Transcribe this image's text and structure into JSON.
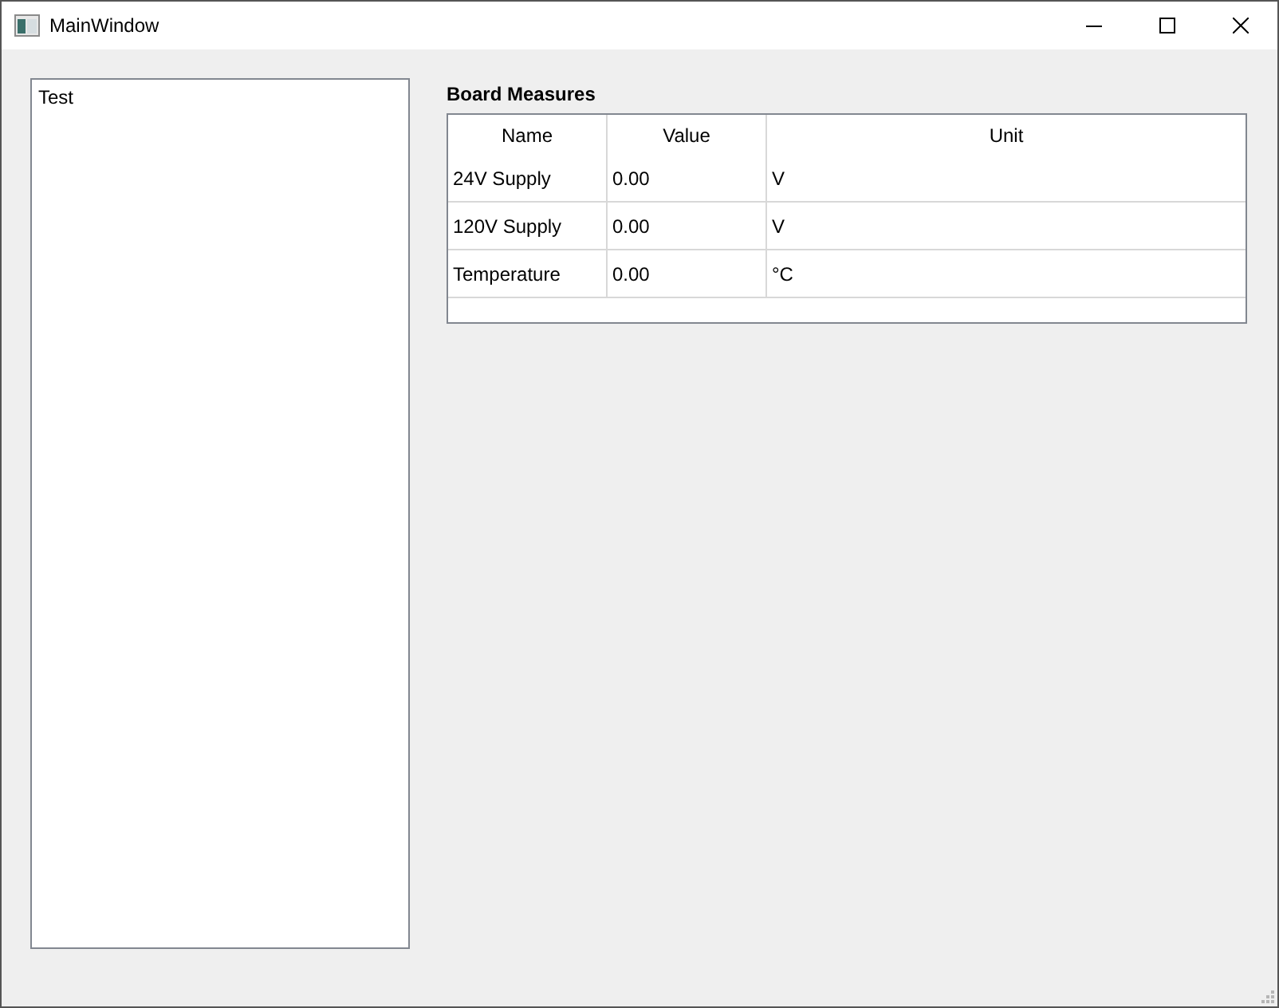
{
  "window": {
    "title": "MainWindow"
  },
  "list": {
    "items": [
      "Test"
    ]
  },
  "measures": {
    "title": "Board Measures",
    "columns": [
      "Name",
      "Value",
      "Unit"
    ],
    "rows": [
      [
        "24V Supply",
        "0.00",
        "V"
      ],
      [
        "120V Supply",
        "0.00",
        "V"
      ],
      [
        "Temperature",
        "0.00",
        "°C"
      ]
    ]
  }
}
